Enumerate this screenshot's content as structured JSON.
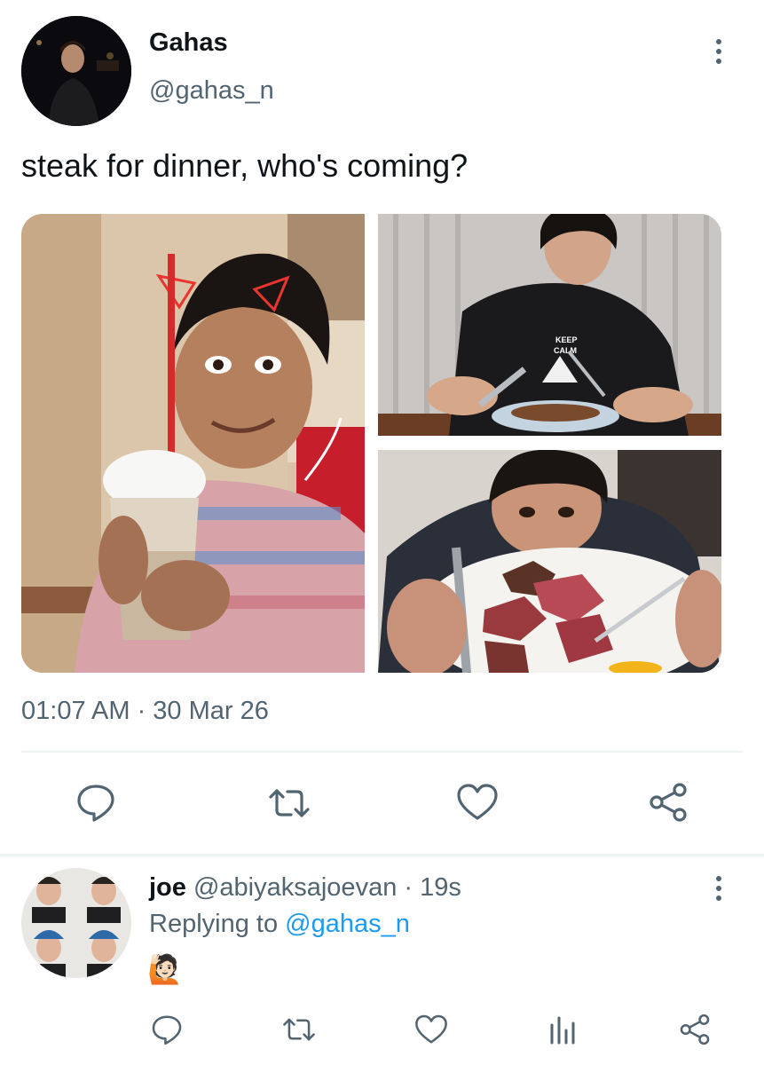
{
  "tweet": {
    "author_name": "Gahas",
    "author_handle": "@gahas_n",
    "text": "steak for dinner, who's coming?",
    "timestamp": "01:07 AM · 30 Mar 26",
    "more_icon": "more-vertical-icon",
    "actions": [
      {
        "icon": "reply-icon"
      },
      {
        "icon": "retweet-icon"
      },
      {
        "icon": "like-icon"
      },
      {
        "icon": "share-icon"
      }
    ]
  },
  "reply": {
    "name": "joe",
    "handle": "@abiyaksajoevan",
    "separator": "·",
    "time": "19s",
    "replying_prefix": "Replying to",
    "replying_mention": "@gahas_n",
    "text": "🙋🏻",
    "actions": [
      {
        "icon": "reply-icon"
      },
      {
        "icon": "retweet-icon"
      },
      {
        "icon": "like-icon"
      },
      {
        "icon": "analytics-icon"
      },
      {
        "icon": "share-icon"
      }
    ]
  },
  "colors": {
    "text_primary": "#0f1419",
    "text_secondary": "#536471",
    "accent": "#1d9bf0",
    "divider": "#eff3f4"
  }
}
